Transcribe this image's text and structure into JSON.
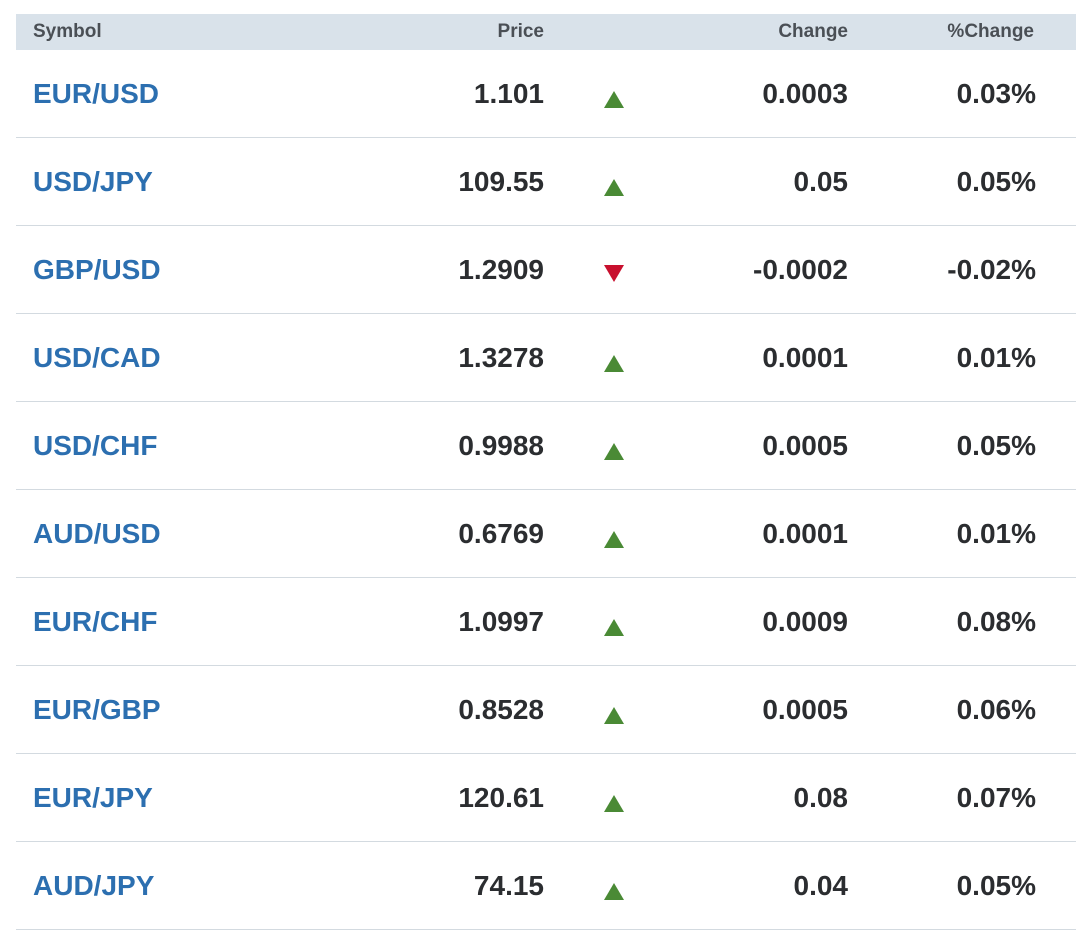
{
  "header": {
    "symbol": "Symbol",
    "price": "Price",
    "change": "Change",
    "pct_change": "%Change"
  },
  "colors": {
    "up": "#4a8a35",
    "down": "#c8102e",
    "link": "#2c6fb0",
    "header_bg": "#d9e2ea"
  },
  "rows": [
    {
      "symbol": "EUR/USD",
      "price": "1.101",
      "direction": "up",
      "change": "0.0003",
      "pct_change": "0.03%"
    },
    {
      "symbol": "USD/JPY",
      "price": "109.55",
      "direction": "up",
      "change": "0.05",
      "pct_change": "0.05%"
    },
    {
      "symbol": "GBP/USD",
      "price": "1.2909",
      "direction": "down",
      "change": "-0.0002",
      "pct_change": "-0.02%"
    },
    {
      "symbol": "USD/CAD",
      "price": "1.3278",
      "direction": "up",
      "change": "0.0001",
      "pct_change": "0.01%"
    },
    {
      "symbol": "USD/CHF",
      "price": "0.9988",
      "direction": "up",
      "change": "0.0005",
      "pct_change": "0.05%"
    },
    {
      "symbol": "AUD/USD",
      "price": "0.6769",
      "direction": "up",
      "change": "0.0001",
      "pct_change": "0.01%"
    },
    {
      "symbol": "EUR/CHF",
      "price": "1.0997",
      "direction": "up",
      "change": "0.0009",
      "pct_change": "0.08%"
    },
    {
      "symbol": "EUR/GBP",
      "price": "0.8528",
      "direction": "up",
      "change": "0.0005",
      "pct_change": "0.06%"
    },
    {
      "symbol": "EUR/JPY",
      "price": "120.61",
      "direction": "up",
      "change": "0.08",
      "pct_change": "0.07%"
    },
    {
      "symbol": "AUD/JPY",
      "price": "74.15",
      "direction": "up",
      "change": "0.04",
      "pct_change": "0.05%"
    }
  ]
}
